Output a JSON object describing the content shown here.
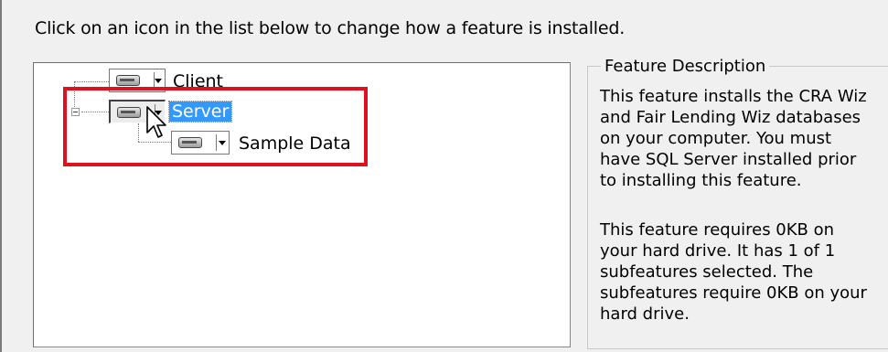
{
  "instruction": "Click on an icon in the list below to change how a feature is installed.",
  "tree": {
    "nodes": [
      {
        "label": "Client",
        "icon": "drive-icon"
      },
      {
        "label": "Server",
        "icon": "drive-icon",
        "selected": true
      },
      {
        "label": "Sample Data",
        "icon": "drive-icon"
      }
    ]
  },
  "description": {
    "title": "Feature Description",
    "paragraph1": "This feature installs the CRA Wiz\nand Fair Lending Wiz databases\non your computer. You must\nhave SQL Server installed prior\nto installing this feature.",
    "paragraph2": "This feature requires 0KB on\nyour hard drive. It has 1 of 1\nsubfeatures selected. The\nsubfeatures require 0KB on your\nhard drive."
  },
  "colors": {
    "highlight": "#e0101e",
    "selection": "#3399ff"
  }
}
